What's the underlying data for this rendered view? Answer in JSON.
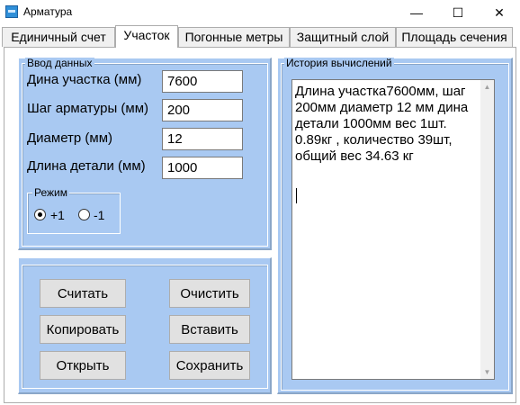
{
  "window": {
    "title": "Арматура",
    "minimize": "—",
    "maximize": "☐",
    "close": "✕"
  },
  "tabs": [
    {
      "label": "Единичный счет"
    },
    {
      "label": "Участок"
    },
    {
      "label": "Погонные метры"
    },
    {
      "label": "Защитный слой"
    },
    {
      "label": "Площадь сечения"
    }
  ],
  "active_tab": "Участок",
  "input": {
    "legend": "Ввод данных",
    "segment_length_label": "Дина участка (мм)",
    "segment_length_value": "7600",
    "step_label": "Шаг арматуры (мм)",
    "step_value": "200",
    "diameter_label": "Диаметр (мм)",
    "diameter_value": "12",
    "part_length_label": "Длина детали (мм)",
    "part_length_value": "1000",
    "mode": {
      "legend": "Режим",
      "plus_label": "+1",
      "minus_label": "-1",
      "selected": "+1"
    }
  },
  "buttons": {
    "calculate": "Считать",
    "clear": "Очистить",
    "copy": "Копировать",
    "paste": "Вставить",
    "open": "Открыть",
    "save": "Сохранить"
  },
  "history": {
    "legend": "История вычислений",
    "text": "Длина участка7600мм, шаг 200мм диаметр 12 мм дина детали 1000мм вес 1шт.  0.89кг , количество 39шт, общий вес 34.63 кг"
  },
  "colors": {
    "panel_bg": "#a9c9f2",
    "button_bg": "#e1e1e1",
    "app_icon": "#2f8fd8"
  }
}
